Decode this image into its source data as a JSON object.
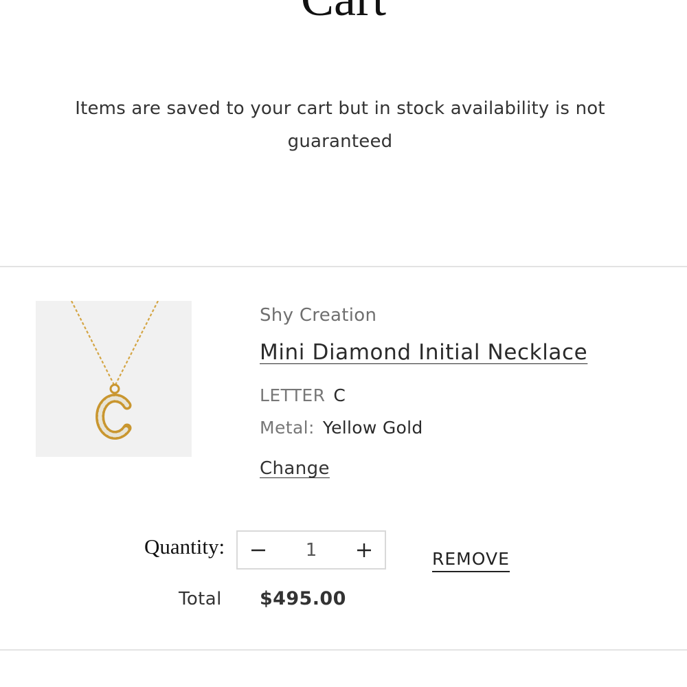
{
  "page": {
    "title": "Cart",
    "notice": "Items are saved to your cart but in stock availability is not guaranteed"
  },
  "cart_item": {
    "image_icon": "necklace-letter-c-image",
    "vendor": "Shy Creation",
    "title": "Mini Diamond Initial Necklace",
    "options": [
      {
        "name": "LETTER",
        "value": "C"
      },
      {
        "name": "Metal:",
        "value": "Yellow Gold"
      }
    ],
    "change_label": "Change",
    "quantity_label": "Quantity:",
    "quantity": "1",
    "decrease_icon": "minus-icon",
    "increase_icon": "plus-icon",
    "remove_label": "REMOVE",
    "total_label": "Total",
    "total_value": "$495.00"
  },
  "colors": {
    "divider": "#e3e3e3",
    "image_bg": "#f1f1f1",
    "gold": "#d4a544",
    "muted_text": "#6f6f6f"
  }
}
